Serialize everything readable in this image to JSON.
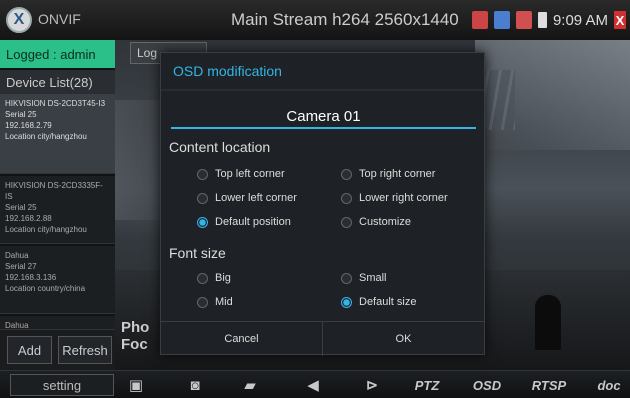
{
  "app": {
    "logo_glyph": "X",
    "name": "ONVIF",
    "title": "Main Stream h264 2560x1440"
  },
  "status_bar": {
    "time": "9:09 AM",
    "close_glyph": "X"
  },
  "sidebar": {
    "logged_label": "Logged : admin",
    "device_list_title": "Device List(28)",
    "devices": [
      {
        "name": "HIKVISION DS-2CD3T45-I3",
        "serial": "Serial 25",
        "ip": "192.168.2.79",
        "location": "Location city/hangzhou"
      },
      {
        "name": "HIKVISION DS-2CD3335F-IS",
        "serial": "Serial 25",
        "ip": "192.168.2.88",
        "location": "Location city/hangzhou"
      },
      {
        "name": "Dahua",
        "serial": "Serial 27",
        "ip": "192.168.3.136",
        "location": "Location country/china"
      },
      {
        "name": "Dahua"
      }
    ],
    "add_label": "Add",
    "refresh_label": "Refresh"
  },
  "camera": {
    "logged_tab": "Log",
    "overlay_line1": "Pho",
    "overlay_line2": "Foc"
  },
  "toolbar": {
    "setting_label": "setting",
    "items": [
      "PTZ",
      "OSD",
      "RTSP",
      "doc"
    ]
  },
  "dialog": {
    "title": "OSD modification",
    "camera_name_value": "Camera 01",
    "content_location_title": "Content location",
    "content_location_options": [
      {
        "label": "Top left corner",
        "selected": false
      },
      {
        "label": "Top right corner",
        "selected": false
      },
      {
        "label": "Lower left corner",
        "selected": false
      },
      {
        "label": "Lower right corner",
        "selected": false
      },
      {
        "label": "Default position",
        "selected": true
      },
      {
        "label": "Customize",
        "selected": false
      }
    ],
    "font_size_title": "Font size",
    "font_size_options": [
      {
        "label": "Big",
        "selected": false
      },
      {
        "label": "Small",
        "selected": false
      },
      {
        "label": "Mid",
        "selected": false
      },
      {
        "label": "Default size",
        "selected": true
      }
    ],
    "cancel_label": "Cancel",
    "ok_label": "OK"
  },
  "colors": {
    "accent": "#34b5e5",
    "logged_bg": "#2bbf8a"
  }
}
